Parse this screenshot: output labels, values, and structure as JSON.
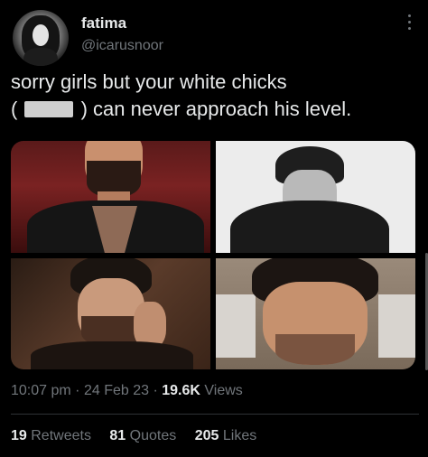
{
  "tweet": {
    "display_name": "fatima",
    "handle": "@icarusnoor",
    "text_line1": "sorry girls but your white chicks",
    "text_line2_pre": "(",
    "text_line2_post": ") can never approach his level.",
    "time": "10:07 pm",
    "date": "24 Feb 23",
    "views_count": "19.6K",
    "views_label": "Views",
    "retweets_count": "19",
    "retweets_label": "Retweets",
    "quotes_count": "81",
    "quotes_label": "Quotes",
    "likes_count": "205",
    "likes_label": "Likes",
    "separator": "·"
  },
  "icons": {
    "more": "more-options-icon"
  },
  "colors": {
    "background": "#000000",
    "text_primary": "#e7e9ea",
    "text_secondary": "#71767b",
    "divider": "#2f3336"
  }
}
